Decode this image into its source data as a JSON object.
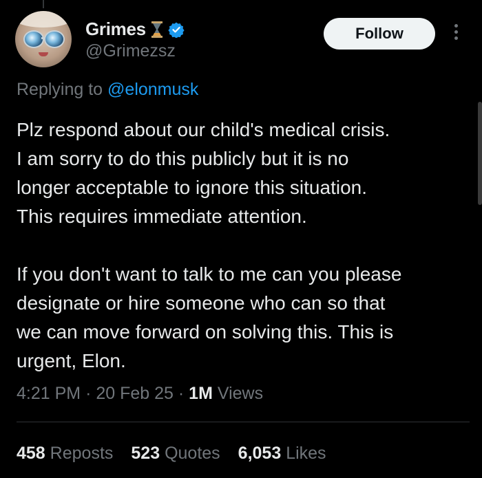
{
  "author": {
    "display_name": "Grimes",
    "handle": "@Grimezsz",
    "verified_color": "#1d9bf0"
  },
  "follow_label": "Follow",
  "reply": {
    "prefix": "Replying to",
    "mention": "@elonmusk"
  },
  "tweet": {
    "paragraph1": "Plz respond about our child's medical crisis.\nI am sorry to do this publicly but it is no\nlonger acceptable to ignore this situation.\nThis requires immediate attention.",
    "paragraph2": "If you don't want to talk to me can you please\ndesignate or hire someone who can so that\nwe can move forward on solving this.   This is\nurgent, Elon."
  },
  "meta": {
    "time": "4:21 PM",
    "date": "20 Feb 25",
    "views_count": "1M",
    "views_label": "Views"
  },
  "stats": {
    "reposts_count": "458",
    "reposts_label": "Reposts",
    "quotes_count": "523",
    "quotes_label": "Quotes",
    "likes_count": "6,053",
    "likes_label": "Likes"
  },
  "icons": [
    "hourglass-icon",
    "verified-icon",
    "more-icon"
  ]
}
